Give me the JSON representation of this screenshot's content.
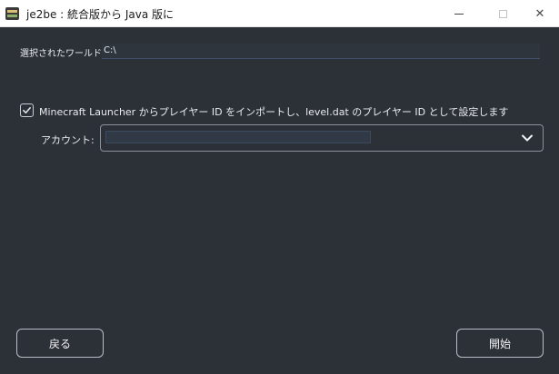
{
  "window": {
    "title": "je2be : 統合版から Java 版に",
    "app_icon": "je2be-app-icon",
    "minimize_label": "",
    "maximize_label": "",
    "close_label": "✕"
  },
  "world": {
    "label": "選択されたワールド:",
    "value": "C:\\"
  },
  "import_option": {
    "checked": true,
    "label": "Minecraft Launcher からプレイヤー ID をインポートし、level.dat のプレイヤー ID として設定します"
  },
  "account": {
    "label": "アカウント:",
    "value": "",
    "dropdown_icon": "chevron-down-icon"
  },
  "buttons": {
    "back_label": "戻る",
    "start_label": "開始"
  },
  "colors": {
    "background": "#2c3138",
    "titlebar": "#ffffff",
    "text": "#e9ecef",
    "field_underline": "#41506b"
  }
}
